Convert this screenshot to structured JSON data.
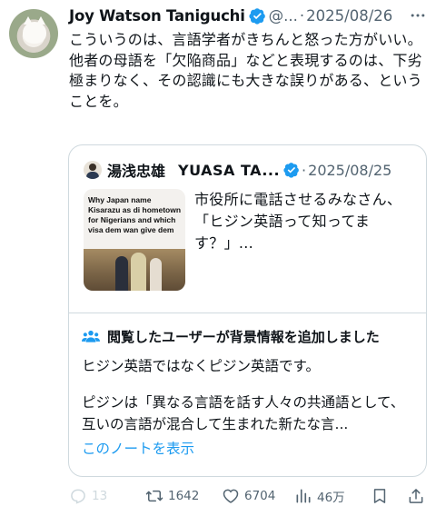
{
  "tweet": {
    "author_name": "Joy Watson Taniguchi",
    "handle": "@...",
    "separator": "·",
    "date": "2025/08/26",
    "text": "こういうのは、言語学者がきちんと怒った方がいい。\n他者の母語を「欠陥商品」などと表現するのは、下劣極まりなく、その認識にも大きな誤りがある、ということを。"
  },
  "quote": {
    "author_name_jp": "湯浅忠雄",
    "author_name_en": "YUASA TA...",
    "separator": "·",
    "date": "2025/08/25",
    "thumbnail_text": "Why Japan name Kisarazu as di hometown for Nigerians and which visa dem wan give dem",
    "text": "市役所に電話させるみなさん、\n「ヒジン英語って知ってます？」..."
  },
  "community_note": {
    "title": "閲覧したユーザーが背景情報を追加しました",
    "line1": "ヒジン英語ではなくピジン英語です。",
    "body": "ピジンは「異なる言語を話す人々の共通語として、互いの言語が混合して生まれた新たな言...",
    "link": "このノートを表示"
  },
  "actions": {
    "replies": "13",
    "retweets": "1642",
    "likes": "6704",
    "views": "46万"
  },
  "colors": {
    "verified_blue": "#1d9bf0",
    "text": "#0f1419",
    "secondary": "#536471",
    "border": "#cfd9de"
  },
  "icons": [
    "verified-icon",
    "more-icon",
    "people-icon",
    "reply-icon",
    "retweet-icon",
    "like-icon",
    "views-icon",
    "bookmark-icon",
    "share-icon"
  ]
}
